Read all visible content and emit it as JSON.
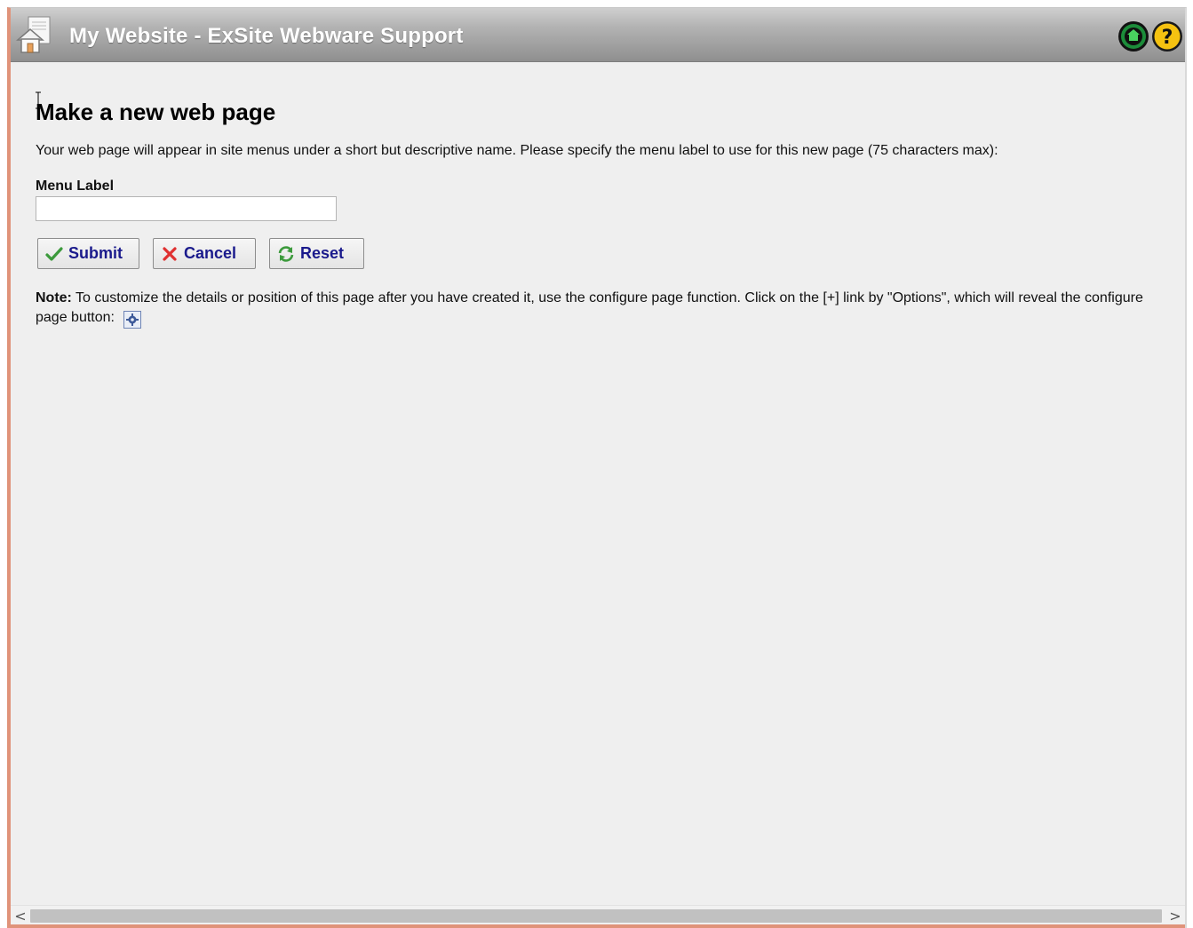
{
  "window": {
    "title": "My Website - ExSite Webware Support"
  },
  "page": {
    "heading": "Make a new web page",
    "intro": "Your web page will appear in site menus under a short but descriptive name. Please specify the menu label to use for this new page (75 characters max):",
    "field_label": "Menu Label",
    "field_value": ""
  },
  "buttons": {
    "submit": "Submit",
    "cancel": "Cancel",
    "reset": "Reset"
  },
  "note": {
    "label": "Note:",
    "text": " To customize the details or position of this page after you have created it, use the configure page function. Click on the [+] link by \"Options\", which will reveal the configure page button:"
  },
  "scrollbar": {
    "left": "<",
    "right": ">"
  },
  "colors": {
    "accent_border": "#e0937a",
    "button_text": "#1a1a8c",
    "background": "#efefef"
  },
  "icons": [
    "home-icon",
    "site-icon",
    "help-icon",
    "check-icon",
    "x-icon",
    "refresh-icon",
    "gear-icon"
  ]
}
